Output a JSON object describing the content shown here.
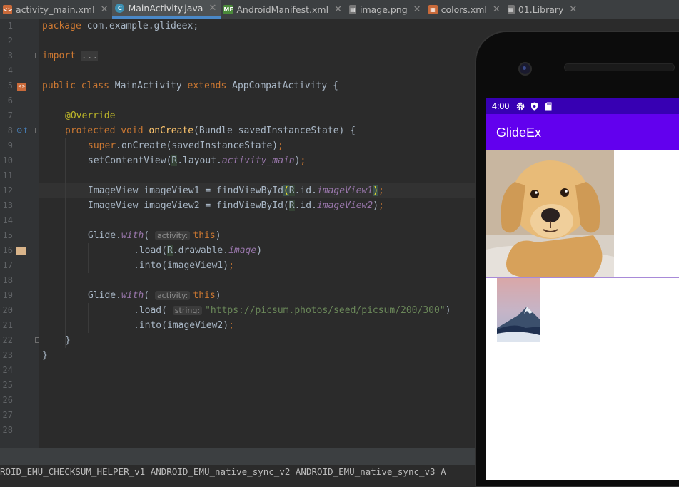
{
  "tabs": [
    {
      "label": "activity_main.xml",
      "icon": "layout-file-icon",
      "color": "#c96a3a",
      "active": false
    },
    {
      "label": "MainActivity.java",
      "icon": "java-class-icon",
      "color": "#3d8fb1",
      "active": true
    },
    {
      "label": "AndroidManifest.xml",
      "icon": "manifest-file-icon",
      "color": "#4b8b3b",
      "active": false
    },
    {
      "label": "image.png",
      "icon": "image-file-icon",
      "color": "#8a8a8a",
      "active": false
    },
    {
      "label": "colors.xml",
      "icon": "values-file-icon",
      "color": "#c96a3a",
      "active": false
    },
    {
      "label": "01.Library",
      "icon": "file-icon",
      "color": "#8a8a8a",
      "active": false
    }
  ],
  "close_glyph": "✕",
  "line_numbers": [
    "1",
    "2",
    "3",
    "4",
    "5",
    "6",
    "7",
    "8",
    "9",
    "10",
    "11",
    "12",
    "13",
    "14",
    "15",
    "16",
    "17",
    "18",
    "19",
    "20",
    "21",
    "22",
    "23",
    "24",
    "25",
    "26",
    "27",
    "28"
  ],
  "code": {
    "l1_kw": "package",
    "l1_rest": " com.example.glideex;",
    "l3_kw": "import",
    "l3_fold": "...",
    "l10_kw1": "public",
    "l10_kw2": "class",
    "l10_name": " MainActivity ",
    "l10_kw3": "extends",
    "l10_rest": " AppCompatActivity {",
    "l12_ann": "@Override",
    "l13_kw1": "protected",
    "l13_kw2": "void",
    "l13_fn": "onCreate",
    "l13_rest": "(Bundle savedInstanceState) {",
    "l14_kw": "super",
    "l14_rest": ".onCreate(savedInstanceState)",
    "l15_a": "setContentView(",
    "l15_r": "R",
    "l15_b": ".layout.",
    "l15_it": "activity_main",
    "l15_c": ")",
    "l17_a": "ImageView imageView1 = findViewById",
    "l17_p1": "(",
    "l17_r": "R",
    "l17_b": ".id.",
    "l17_it": "imageView1",
    "l17_p2": ")",
    "l18_a": "ImageView imageView2 = findViewById(",
    "l18_r": "R",
    "l18_b": ".id.",
    "l18_it": "imageView2",
    "l18_c": ")",
    "l20_a": "Glide.",
    "l20_it": "with",
    "l20_b": "(",
    "l20_hint": "activity:",
    "l20_kw": "this",
    "l20_c": ")",
    "l21_a": ".load(",
    "l21_r": "R",
    "l21_b": ".drawable.",
    "l21_it": "image",
    "l21_c": ")",
    "l22": ".into(imageView1)",
    "l24_a": "Glide.",
    "l24_it": "with",
    "l24_b": "(",
    "l24_hint": "activity:",
    "l24_kw": "this",
    "l24_c": ")",
    "l25_a": ".load(",
    "l25_hint": "string:",
    "l25_q1": "\"",
    "l25_str": "https://picsum.photos/seed/picsum/200/300",
    "l25_q2": "\"",
    "l25_c": ")",
    "l26": ".into(imageView2)",
    "l27": "}",
    "l28": "}",
    "semi": ";"
  },
  "log_text": "ROID_EMU_CHECKSUM_HELPER_v1 ANDROID_EMU_native_sync_v2 ANDROID_EMU_native_sync_v3 A",
  "device": {
    "time": "4:00",
    "status_icons": [
      "gear-icon",
      "shield-icon",
      "sd-card-icon"
    ],
    "app_title": "GlideEx",
    "colors": {
      "status": "#3700b3",
      "appbar": "#6200ee"
    },
    "images": [
      "puppy-photo",
      "mountain-photo"
    ]
  }
}
